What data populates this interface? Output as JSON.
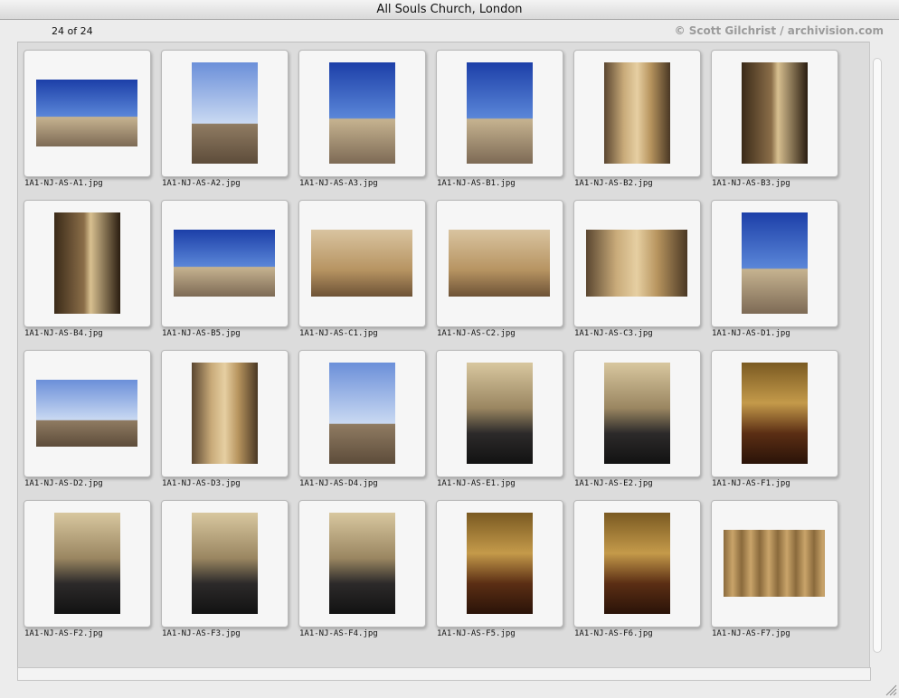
{
  "window": {
    "title": "All Souls Church, London"
  },
  "info": {
    "count": "24 of 24",
    "credit": "© Scott Gilchrist / archivision.com"
  },
  "thumbnails": [
    {
      "file": "1A1-NJ-AS-A1.jpg",
      "style": "sky"
    },
    {
      "file": "1A1-NJ-AS-A2.jpg",
      "style": "sky2"
    },
    {
      "file": "1A1-NJ-AS-A3.jpg",
      "style": "sky"
    },
    {
      "file": "1A1-NJ-AS-B1.jpg",
      "style": "sky"
    },
    {
      "file": "1A1-NJ-AS-B2.jpg",
      "style": "stone"
    },
    {
      "file": "1A1-NJ-AS-B3.jpg",
      "style": "dark"
    },
    {
      "file": "1A1-NJ-AS-B4.jpg",
      "style": "dark"
    },
    {
      "file": "1A1-NJ-AS-B5.jpg",
      "style": "sky"
    },
    {
      "file": "1A1-NJ-AS-C1.jpg",
      "style": "stone2"
    },
    {
      "file": "1A1-NJ-AS-C2.jpg",
      "style": "stone2"
    },
    {
      "file": "1A1-NJ-AS-C3.jpg",
      "style": "stone"
    },
    {
      "file": "1A1-NJ-AS-D1.jpg",
      "style": "sky"
    },
    {
      "file": "1A1-NJ-AS-D2.jpg",
      "style": "sky2"
    },
    {
      "file": "1A1-NJ-AS-D3.jpg",
      "style": "stone"
    },
    {
      "file": "1A1-NJ-AS-D4.jpg",
      "style": "sky2"
    },
    {
      "file": "1A1-NJ-AS-E1.jpg",
      "style": "interior"
    },
    {
      "file": "1A1-NJ-AS-E2.jpg",
      "style": "interior"
    },
    {
      "file": "1A1-NJ-AS-F1.jpg",
      "style": "interior2"
    },
    {
      "file": "1A1-NJ-AS-F2.jpg",
      "style": "interior"
    },
    {
      "file": "1A1-NJ-AS-F3.jpg",
      "style": "interior"
    },
    {
      "file": "1A1-NJ-AS-F4.jpg",
      "style": "interior"
    },
    {
      "file": "1A1-NJ-AS-F5.jpg",
      "style": "interior2"
    },
    {
      "file": "1A1-NJ-AS-F6.jpg",
      "style": "interior2"
    },
    {
      "file": "1A1-NJ-AS-F7.jpg",
      "style": "ceiling"
    }
  ]
}
